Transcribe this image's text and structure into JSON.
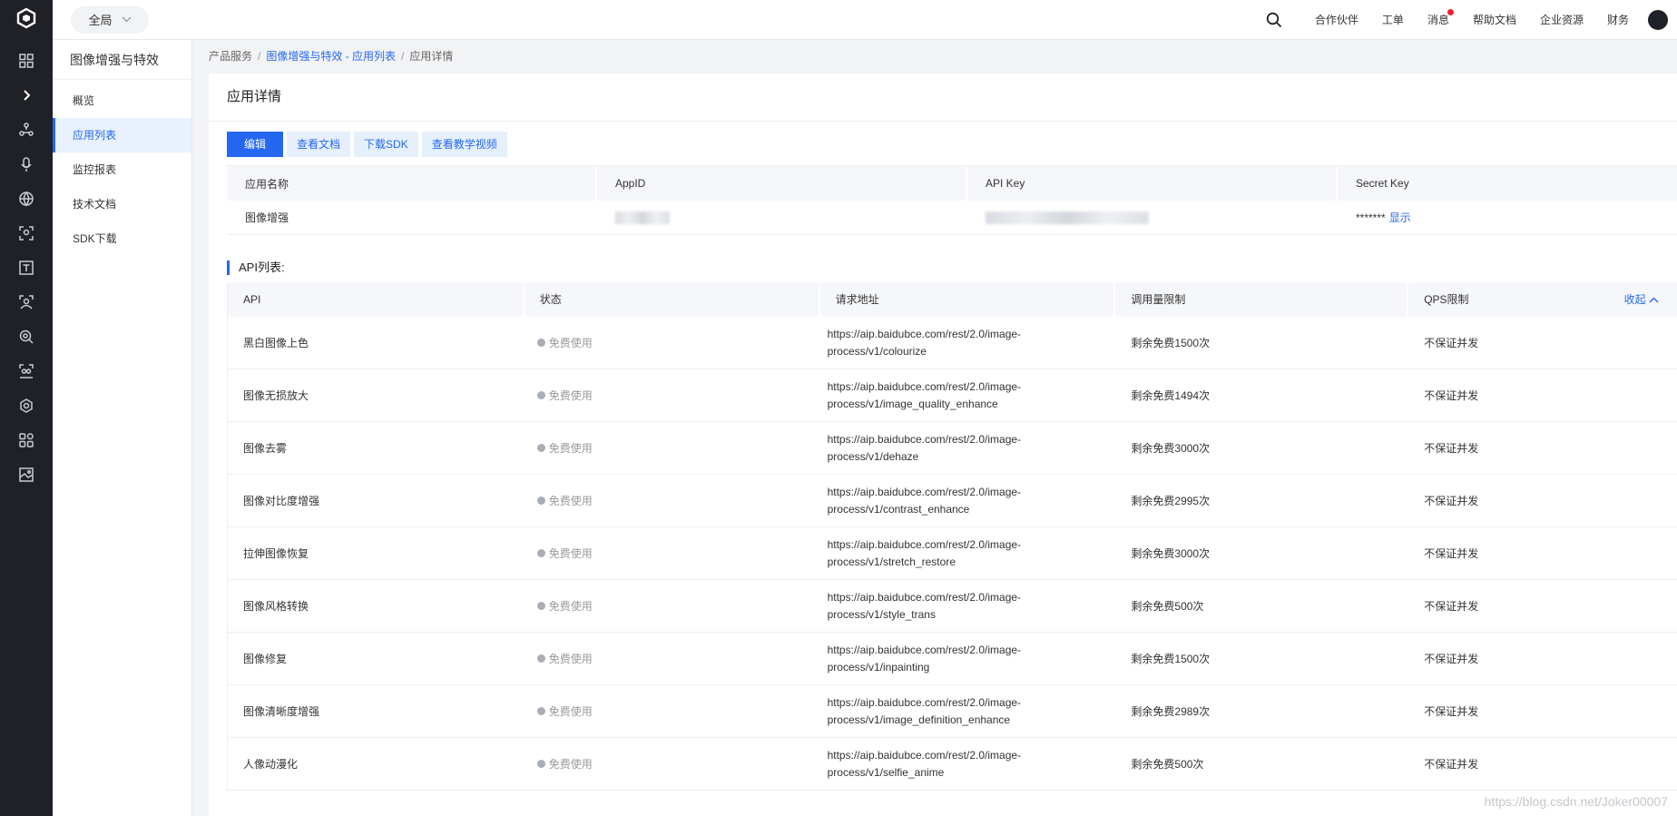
{
  "topbar": {
    "region": "全局",
    "nav": [
      "合作伙伴",
      "工单",
      "消息",
      "帮助文档",
      "企业资源",
      "财务"
    ]
  },
  "subnav": {
    "title": "图像增强与特效",
    "items": [
      "概览",
      "应用列表",
      "监控报表",
      "技术文档",
      "SDK下载"
    ]
  },
  "breadcrumb": {
    "root": "产品服务",
    "parent": "图像增强与特效 - 应用列表",
    "current": "应用详情"
  },
  "page": {
    "title": "应用详情",
    "buttons": [
      "编辑",
      "查看文档",
      "下载SDK",
      "查看教学视频"
    ]
  },
  "app_info": {
    "headers": [
      "应用名称",
      "AppID",
      "API Key",
      "Secret Key"
    ],
    "name": "图像增强",
    "secret_mask": "*******",
    "show_label": "显示"
  },
  "api_list": {
    "title": "API列表:",
    "headers": [
      "API",
      "状态",
      "请求地址",
      "调用量限制",
      "QPS限制"
    ],
    "collapse_label": "收起",
    "rows": [
      {
        "api": "黑白图像上色",
        "status": "免费使用",
        "url1": "https://aip.baidubce.com/rest/2.0/image-",
        "url2": "process/v1/colourize",
        "limit": "剩余免费1500次",
        "qps": "不保证并发"
      },
      {
        "api": "图像无损放大",
        "status": "免费使用",
        "url1": "https://aip.baidubce.com/rest/2.0/image-",
        "url2": "process/v1/image_quality_enhance",
        "limit": "剩余免费1494次",
        "qps": "不保证并发"
      },
      {
        "api": "图像去雾",
        "status": "免费使用",
        "url1": "https://aip.baidubce.com/rest/2.0/image-",
        "url2": "process/v1/dehaze",
        "limit": "剩余免费3000次",
        "qps": "不保证并发"
      },
      {
        "api": "图像对比度增强",
        "status": "免费使用",
        "url1": "https://aip.baidubce.com/rest/2.0/image-",
        "url2": "process/v1/contrast_enhance",
        "limit": "剩余免费2995次",
        "qps": "不保证并发"
      },
      {
        "api": "拉伸图像恢复",
        "status": "免费使用",
        "url1": "https://aip.baidubce.com/rest/2.0/image-",
        "url2": "process/v1/stretch_restore",
        "limit": "剩余免费3000次",
        "qps": "不保证并发"
      },
      {
        "api": "图像风格转换",
        "status": "免费使用",
        "url1": "https://aip.baidubce.com/rest/2.0/image-",
        "url2": "process/v1/style_trans",
        "limit": "剩余免费500次",
        "qps": "不保证并发"
      },
      {
        "api": "图像修复",
        "status": "免费使用",
        "url1": "https://aip.baidubce.com/rest/2.0/image-",
        "url2": "process/v1/inpainting",
        "limit": "剩余免费1500次",
        "qps": "不保证并发"
      },
      {
        "api": "图像清晰度增强",
        "status": "免费使用",
        "url1": "https://aip.baidubce.com/rest/2.0/image-",
        "url2": "process/v1/image_definition_enhance",
        "limit": "剩余免费2989次",
        "qps": "不保证并发"
      },
      {
        "api": "人像动漫化",
        "status": "免费使用",
        "url1": "https://aip.baidubce.com/rest/2.0/image-",
        "url2": "process/v1/selfie_anime",
        "limit": "剩余免费500次",
        "qps": "不保证并发"
      }
    ]
  },
  "watermark": "https://blog.csdn.net/Joker00007",
  "colors": {
    "accent": "#2468f2",
    "rail": "#1f2126"
  }
}
